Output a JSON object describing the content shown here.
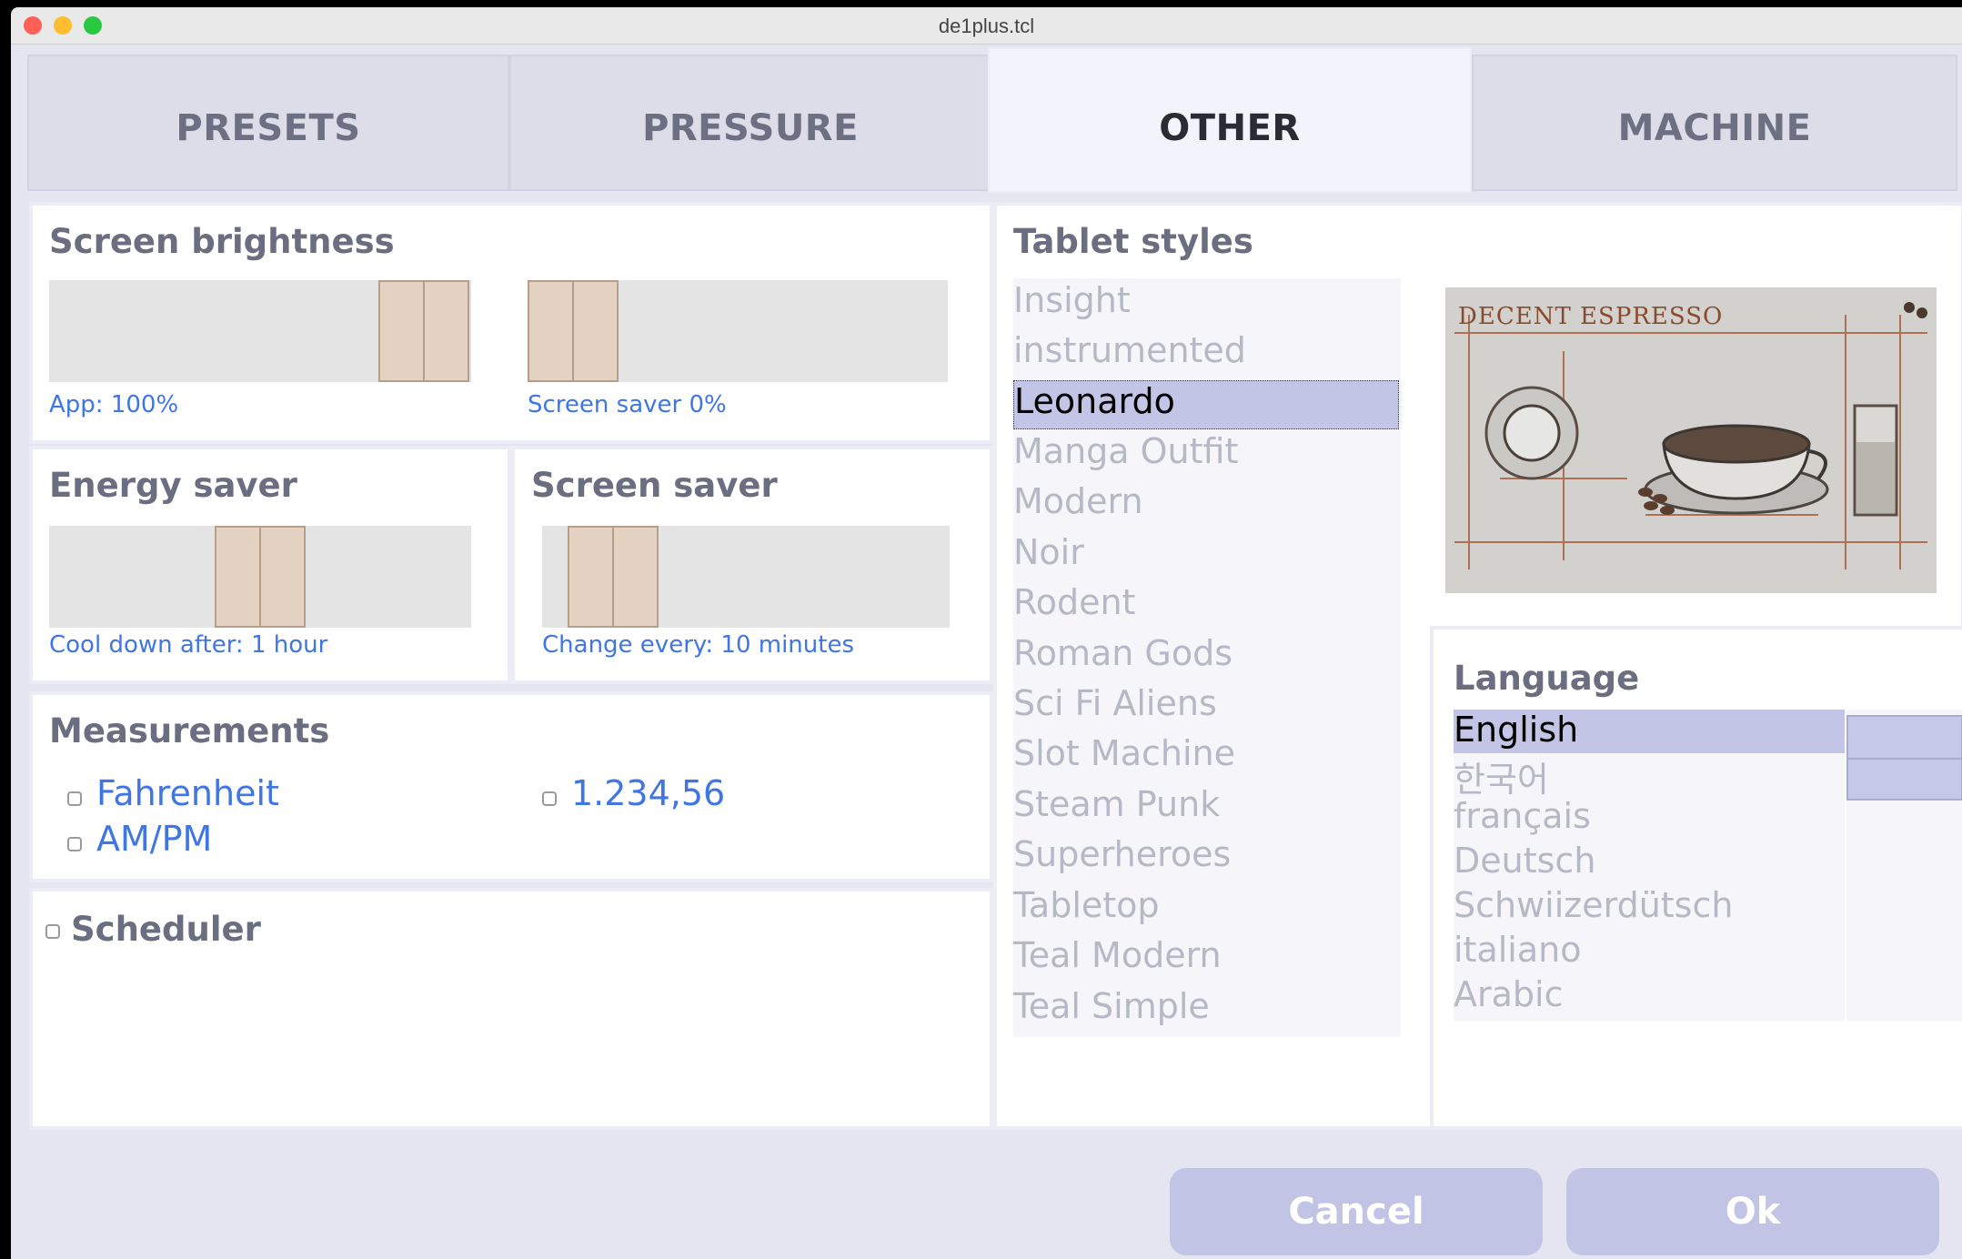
{
  "window": {
    "title": "de1plus.tcl"
  },
  "tabs": [
    "PRESETS",
    "PRESSURE",
    "OTHER",
    "MACHINE"
  ],
  "active_tab": "OTHER",
  "brightness": {
    "title": "Screen brightness",
    "app_label": "App: 100%",
    "app_level": 1.0,
    "saver_label": "Screen saver 0%",
    "saver_level": 0.0
  },
  "energy_saver": {
    "title": "Energy saver",
    "label": "Cool down after: 1 hour"
  },
  "screen_saver": {
    "title": "Screen saver",
    "label": "Change every: 10 minutes"
  },
  "measurements": {
    "title": "Measurements",
    "fahrenheit": "Fahrenheit",
    "ampm": "AM/PM",
    "number_format": "1.234,56"
  },
  "scheduler": {
    "title": "Scheduler"
  },
  "tablet_styles": {
    "title": "Tablet styles",
    "items": [
      "Insight",
      "instrumented",
      "Leonardo",
      "Manga Outfit",
      "Modern",
      "Noir",
      "Rodent",
      "Roman Gods",
      "Sci Fi Aliens",
      "Slot Machine",
      "Steam Punk",
      "Superheroes",
      "Tabletop",
      "Teal Modern",
      "Teal Simple"
    ],
    "selected": "Leonardo",
    "preview_caption": "DECENT ESPRESSO"
  },
  "language": {
    "title": "Language",
    "items": [
      "English",
      "한국어",
      "français",
      "Deutsch",
      "Schwiizerdütsch",
      "italiano",
      "Arabic"
    ],
    "selected": "English"
  },
  "buttons": {
    "cancel": "Cancel",
    "ok": "Ok"
  },
  "colors": {
    "accent_text": "#3f76e4",
    "selection": "#c2c5e6",
    "thumb": "#e4d3c3",
    "button": "#c2c4e6"
  }
}
